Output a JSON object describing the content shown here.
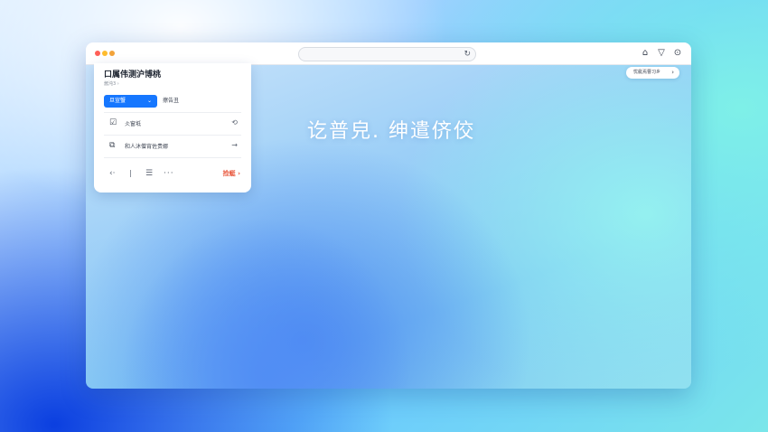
{
  "browser": {
    "address_reload_icon": "reload-icon",
    "toolbar_icons": [
      "home-icon",
      "shield-icon",
      "download-icon"
    ]
  },
  "panel": {
    "title": "口属伟测沪博桃",
    "subtitle": "酱沌3 ›",
    "primary_button": "旦宣蟹",
    "primary_chevron": "⌄",
    "secondary_button": "擦告丑",
    "rows": [
      {
        "icon": "edit-icon",
        "label": "仌窗坻",
        "arrow": "⟲"
      },
      {
        "icon": "copy-icon",
        "label": "和人沐僧宵佐贵娜",
        "arrow": "→"
      }
    ],
    "tools": {
      "back": "‹·",
      "sep": "|",
      "menu": "☰",
      "more": "···"
    },
    "link": "捡蜓 ›"
  },
  "pill": {
    "label": "忧艇焉曹习乡",
    "chevron": "›"
  },
  "hero_text": "讫普皃. 绅遣侪佼",
  "colors": {
    "primary": "#1677ff",
    "link": "#e8553a",
    "close": "#ff5f57",
    "minimize": "#febc2e"
  }
}
